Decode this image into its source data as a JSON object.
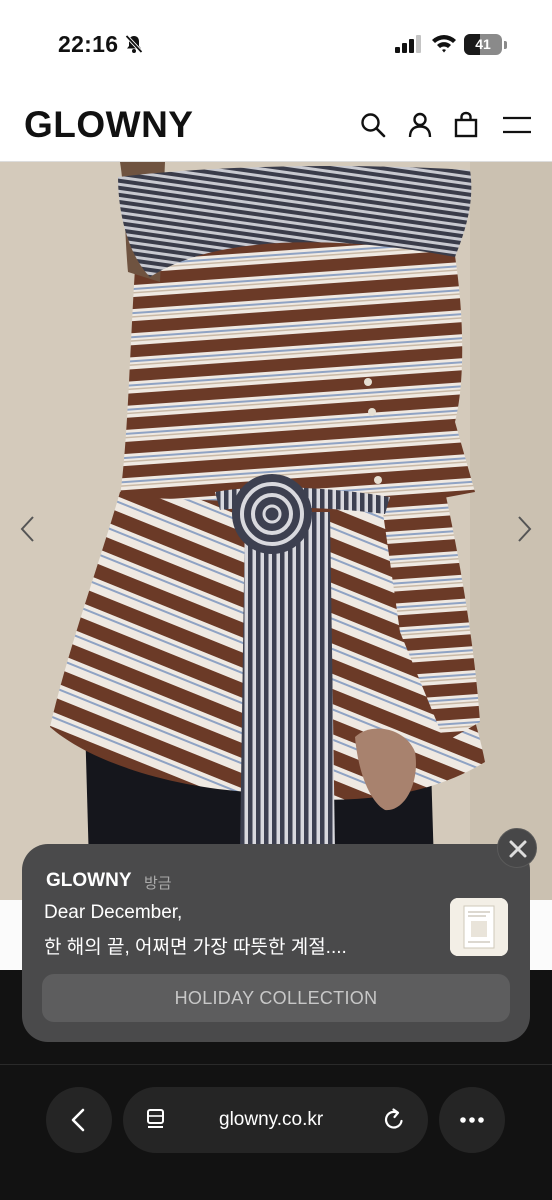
{
  "status_bar": {
    "time": "22:16",
    "battery": "41",
    "battery_level": 0.41,
    "icons": [
      "bell-slash-icon",
      "signal-icon",
      "wifi-icon",
      "battery-icon"
    ]
  },
  "header": {
    "logo": "GLOWNY",
    "icons": [
      "search-icon",
      "account-icon",
      "bag-icon",
      "menu-icon"
    ]
  },
  "hero": {
    "prev_icon": "chevron-left-icon",
    "next_icon": "chevron-right-icon"
  },
  "notification": {
    "app": "GLOWNY",
    "time": "방금",
    "line1": "Dear December,",
    "line2": "한 해의 끝, 어쩌면 가장 따뜻한 계절....",
    "button": "HOLIDAY COLLECTION",
    "close_icon": "close-icon"
  },
  "browser": {
    "url": "glowny.co.kr",
    "icons": [
      "back-icon",
      "tab-list-icon",
      "reload-icon",
      "more-icon"
    ]
  },
  "colors": {
    "stripe_brown": "#6b3a27",
    "stripe_navy": "#3d4050",
    "backdrop": "#d4cabb",
    "notification_bg": "#4a4a4b"
  }
}
